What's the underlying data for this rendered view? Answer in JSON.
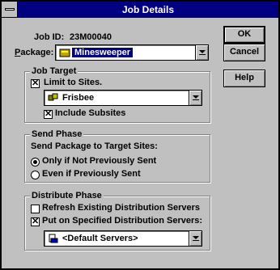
{
  "window": {
    "title": "Job Details"
  },
  "job": {
    "id_label": "Job ID:",
    "id_value": "23M00040"
  },
  "package": {
    "label": "Package:",
    "value": "Minesweeper"
  },
  "job_target": {
    "group_label": "Job Target",
    "limit_to_sites_label": "Limit to Sites.",
    "limit_to_sites_checked": true,
    "site_value": "Frisbee",
    "include_subsites_label": "Include Subsites",
    "include_subsites_checked": true
  },
  "send_phase": {
    "group_label": "Send Phase",
    "prompt": "Send Package to Target Sites:",
    "options": [
      {
        "label": "Only if Not Previously Sent",
        "selected": true
      },
      {
        "label": "Even if Previously Sent",
        "selected": false
      }
    ]
  },
  "distribute_phase": {
    "group_label": "Distribute Phase",
    "refresh_label": "Refresh Existing Distribution Servers",
    "refresh_checked": false,
    "put_on_label": "Put on Specified Distribution Servers:",
    "put_on_checked": true,
    "servers_value": "<Default Servers>"
  },
  "buttons": {
    "ok": "OK",
    "cancel": "Cancel",
    "help": "Help"
  },
  "icons": [
    "system-menu-icon",
    "package-icon",
    "site-icon",
    "server-icon",
    "dropdown-arrow-icon"
  ]
}
